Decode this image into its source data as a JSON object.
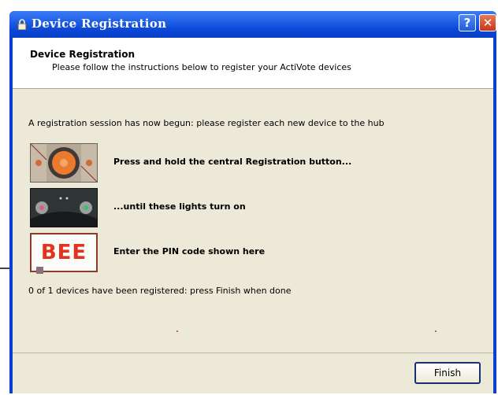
{
  "window": {
    "title": "Device Registration",
    "help_glyph": "?",
    "close_glyph": "✕"
  },
  "header": {
    "title": "Device Registration",
    "subtitle": "Please follow the instructions below to register your ActiVote devices"
  },
  "intro": "A registration session has now begun: please register each new device to the hub",
  "steps": [
    {
      "image": "hub-button-photo",
      "text": "Press and hold the central Registration button..."
    },
    {
      "image": "hub-lights-photo",
      "text": "...until these lights turn on"
    },
    {
      "image": "pin-code-display",
      "pin": "BEE",
      "text": "Enter the PIN code shown here"
    }
  ],
  "status": "0 of 1 devices have been registered: press Finish when done",
  "buttons": {
    "finish": "Finish"
  },
  "colors": {
    "pin_text": "#e2331f",
    "title_bar": "#1f5fe6",
    "close_button": "#c8361a"
  }
}
